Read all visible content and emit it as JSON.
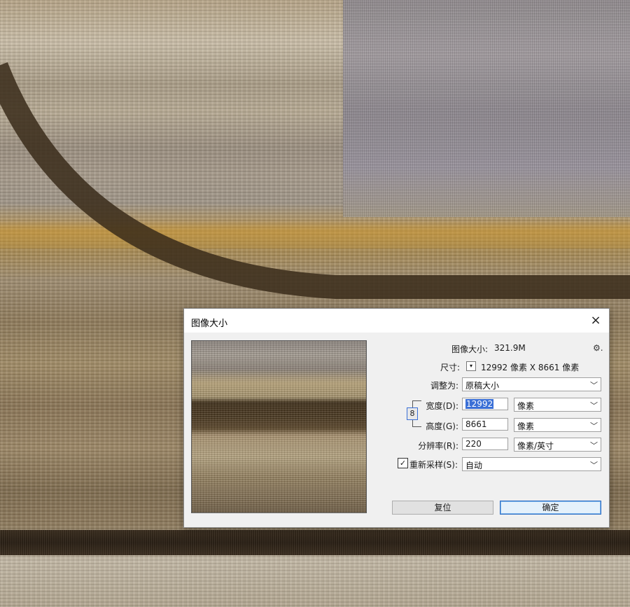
{
  "dialog": {
    "title": "图像大小",
    "close_icon": "×",
    "gear_icon": "⚙.",
    "image_size_label": "图像大小:",
    "image_size_value": "321.9M",
    "dimensions_label": "尺寸:",
    "dimensions_value": "12992 像素  X  8661 像素",
    "fit_to_label": "调整为:",
    "fit_to_value": "原稿大小",
    "width_label": "宽度(D):",
    "width_value": "12992",
    "width_unit": "像素",
    "height_label": "高度(G):",
    "height_value": "8661",
    "height_unit": "像素",
    "resolution_label": "分辨率(R):",
    "resolution_value": "220",
    "resolution_unit": "像素/英寸",
    "resample_label": "重新采样(S):",
    "resample_checked": "✓",
    "resample_value": "自动",
    "reset_button": "复位",
    "ok_button": "确定",
    "chevron": "﹀",
    "tiny_chevron": "▾",
    "chain_icon": "8"
  }
}
